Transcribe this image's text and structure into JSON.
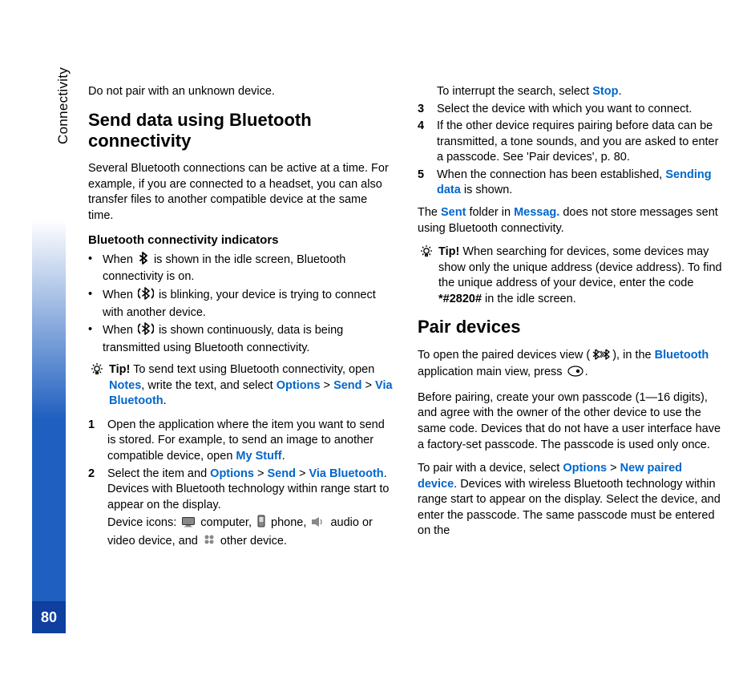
{
  "sideLabel": "Connectivity",
  "pageNumber": "80",
  "col1": {
    "p1": "Do not pair with an unknown device.",
    "h2": "Send data using Bluetooth connectivity",
    "p2": "Several Bluetooth connections can be active at a time. For example, if you are connected to a headset, you can also transfer files to another compatible device at the same time.",
    "h3": "Bluetooth connectivity indicators",
    "bullets": {
      "b1a": "When ",
      "b1b": " is shown in the idle screen, Bluetooth connectivity is on.",
      "b2a": "When ",
      "b2b": " is blinking, your device is trying to connect with another device.",
      "b3a": "When ",
      "b3b": " is shown continuously, data is being transmitted using Bluetooth connectivity."
    },
    "tip": {
      "label": "Tip!",
      "t1": " To send text using Bluetooth connectivity, open ",
      "notes": "Notes",
      "t2": ", write the text, and select ",
      "options": "Options",
      "gt1": " > ",
      "send": "Send",
      "gt2": " > ",
      "via": "Via Bluetooth",
      "t3": "."
    },
    "steps": {
      "s1a": "Open the application where the item you want to send is stored. For example, to send an image to another compatible device, open ",
      "s1link": "My Stuff",
      "s1b": ".",
      "s2a": "Select the item and ",
      "s2options": "Options",
      "s2gt1": " > ",
      "s2send": "Send",
      "s2gt2": " > ",
      "s2via": "Via Bluetooth",
      "s2b": ". Devices with Bluetooth technology within range start to appear on the display.",
      "s2c_a": "Device icons: ",
      "s2c_b": " computer, ",
      "s2c_c": " phone, ",
      "s2c_d": " audio or video device, and ",
      "s2c_e": " other device."
    }
  },
  "col2": {
    "p1a": "To interrupt the search, select ",
    "p1link": "Stop",
    "p1b": ".",
    "s3": "Select the device with which you want to connect.",
    "s4": "If the other device requires pairing before data can be transmitted, a tone sounds, and you are asked to enter a passcode. See 'Pair devices', p. 80.",
    "s5a": "When the connection has been established, ",
    "s5link": "Sending data",
    "s5b": " is shown.",
    "p2a": "The ",
    "p2sent": "Sent",
    "p2b": " folder in ",
    "p2mess": "Messag.",
    "p2c": " does not store messages sent using Bluetooth connectivity.",
    "tip": {
      "label": "Tip!",
      "t1": " When searching for devices, some devices may show only the unique address (device address). To find the unique address of your device, enter the code ",
      "code": "*#2820#",
      "t2": " in the idle screen."
    },
    "h2": "Pair devices",
    "p3a": "To open the paired devices view (",
    "p3b": "), in the ",
    "p3link": "Bluetooth",
    "p3c": " application main view, press ",
    "p3d": ".",
    "p4": "Before pairing, create your own passcode (1—16 digits), and agree with the owner of the other device to use the same code. Devices that do not have a user interface have a factory-set passcode. The passcode is used only once.",
    "p5a": "To pair with a device, select ",
    "p5opt": "Options",
    "p5gt": " > ",
    "p5new": "New paired device",
    "p5b": ". Devices with wireless Bluetooth technology within range start to appear on the display. Select the device, and enter the passcode. The same passcode must be entered on the"
  }
}
